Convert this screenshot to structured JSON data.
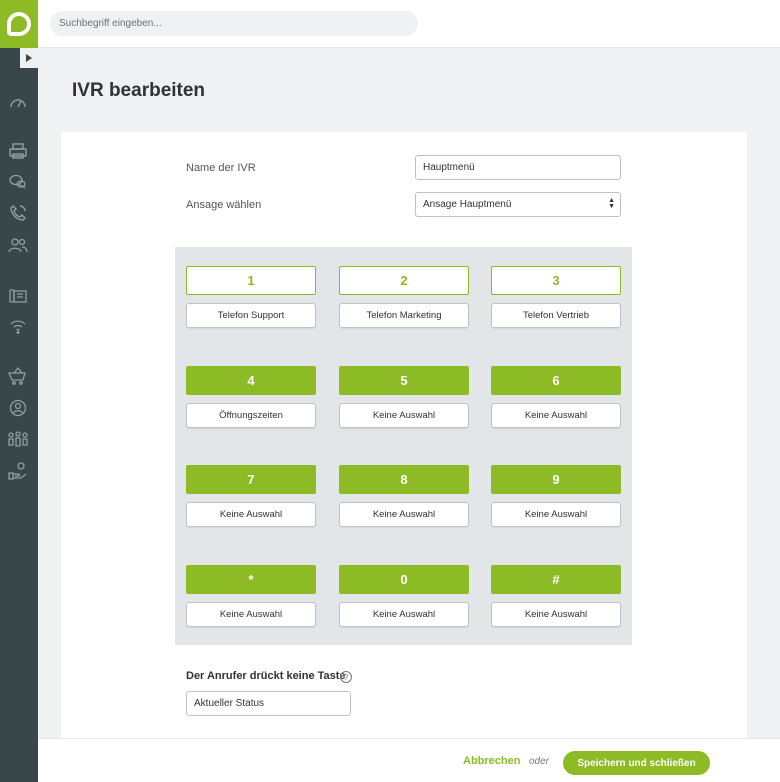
{
  "search": {
    "placeholder": "Suchbegriff eingeben..."
  },
  "page": {
    "title": "IVR bearbeiten"
  },
  "form": {
    "name_label": "Name der IVR",
    "name_value": "Hauptmenü",
    "announcement_label": "Ansage wählen",
    "announcement_value": "Ansage Hauptmenü"
  },
  "keypad": {
    "keys": [
      {
        "key": "1",
        "target": "Telefon Support",
        "style": "outline"
      },
      {
        "key": "2",
        "target": "Telefon Marketing",
        "style": "outline"
      },
      {
        "key": "3",
        "target": "Telefon Vertrieb",
        "style": "outline"
      },
      {
        "key": "4",
        "target": "Öffnungszeiten",
        "style": "filled"
      },
      {
        "key": "5",
        "target": "Keine Auswahl",
        "style": "filled"
      },
      {
        "key": "6",
        "target": "Keine Auswahl",
        "style": "filled"
      },
      {
        "key": "7",
        "target": "Keine Auswahl",
        "style": "filled"
      },
      {
        "key": "8",
        "target": "Keine Auswahl",
        "style": "filled"
      },
      {
        "key": "9",
        "target": "Keine Auswahl",
        "style": "filled"
      },
      {
        "key": "*",
        "target": "Keine Auswahl",
        "style": "filled"
      },
      {
        "key": "0",
        "target": "Keine Auswahl",
        "style": "filled"
      },
      {
        "key": "#",
        "target": "Keine Auswahl",
        "style": "filled"
      }
    ]
  },
  "no_key": {
    "label": "Der Anrufer drückt keine Taste",
    "help": "?",
    "value": "Aktueller Status"
  },
  "footer": {
    "cancel": "Abbrechen",
    "or": "oder",
    "save": "Speichern und schließen"
  },
  "colors": {
    "accent": "#8dbb25",
    "sidebar": "#37474a"
  },
  "sidebar_icons": [
    "dashboard-icon",
    "fax-icon",
    "chat-icon",
    "phone-icon",
    "users-icon",
    "desk-phone-icon",
    "wifi-icon",
    "cart-icon",
    "user-circle-icon",
    "team-icon",
    "hand-coin-icon"
  ]
}
